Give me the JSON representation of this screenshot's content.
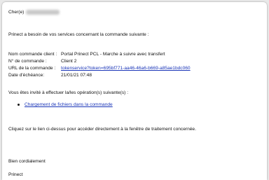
{
  "greeting": {
    "label": "Cher(e)"
  },
  "intro": "Prinect   a besoin de vos services concernant la commande suivante :",
  "details": {
    "order_name_key": "Nom commande client :",
    "order_name_value": "Portal Prinect PCL - Marche à suivre avec transfert",
    "order_no_key": "N° de commande :",
    "order_no_value": "Client 2",
    "url_key": "URL de la commande :",
    "url_value": "tokenservice?token=695bf771-aa46-46a6-b669-a85ae1bdc060",
    "due_key": "Date d'échéance:",
    "due_value": "21/01/21 07:48"
  },
  "invite": "Vous êtes invité à effectuer la/les opération(s) suivante(s) :",
  "operation_link": "Chargement de fichiers dans la commande",
  "instruction": "Cliquez sur le lien ci-dessus pour accéder directement à la fenêtre de traitement concernée.",
  "closing": "Bien cordialement",
  "signature": "Prinect"
}
